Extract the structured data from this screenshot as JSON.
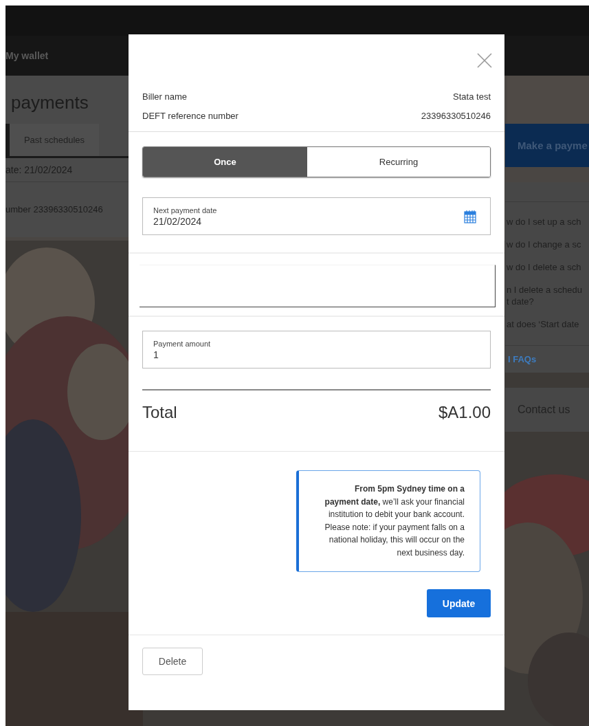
{
  "top_nav": {
    "title": "My wallet"
  },
  "page": {
    "heading": "payments",
    "tabs": [
      {
        "label": "Past schedules",
        "selected": false
      }
    ],
    "schedule_date": "ate: 21/02/2024",
    "reference": "umber 23396330510246"
  },
  "sidebar": {
    "action_button": "Make a payme",
    "faqs": [
      "w do I set up a sch",
      "w do I change a sc",
      "w do I delete a sch",
      "n I delete a schedu\nt date?",
      "at does ‘Start date"
    ],
    "faqs_link": "l FAQs",
    "contact": "Contact us"
  },
  "modal": {
    "details": [
      {
        "label": "Biller name",
        "value": "Stata test"
      },
      {
        "label": "DEFT reference number",
        "value": "23396330510246"
      }
    ],
    "frequency": [
      {
        "label": "Once",
        "selected": true
      },
      {
        "label": "Recurring",
        "selected": false
      }
    ],
    "date_field": {
      "label": "Next payment date",
      "value": "21/02/2024"
    },
    "amount_field": {
      "label": "Payment amount",
      "value": "1"
    },
    "total": {
      "label": "Total",
      "value": "$A1.00"
    },
    "notice": "**From 5pm Sydney time on a payment date,** we’ll ask your financial institution to debit your bank account.\nPlease note: if your payment falls on a national holiday, this will occur on the next business day.",
    "primary_button": "Update",
    "secondary_button": "Delete"
  }
}
